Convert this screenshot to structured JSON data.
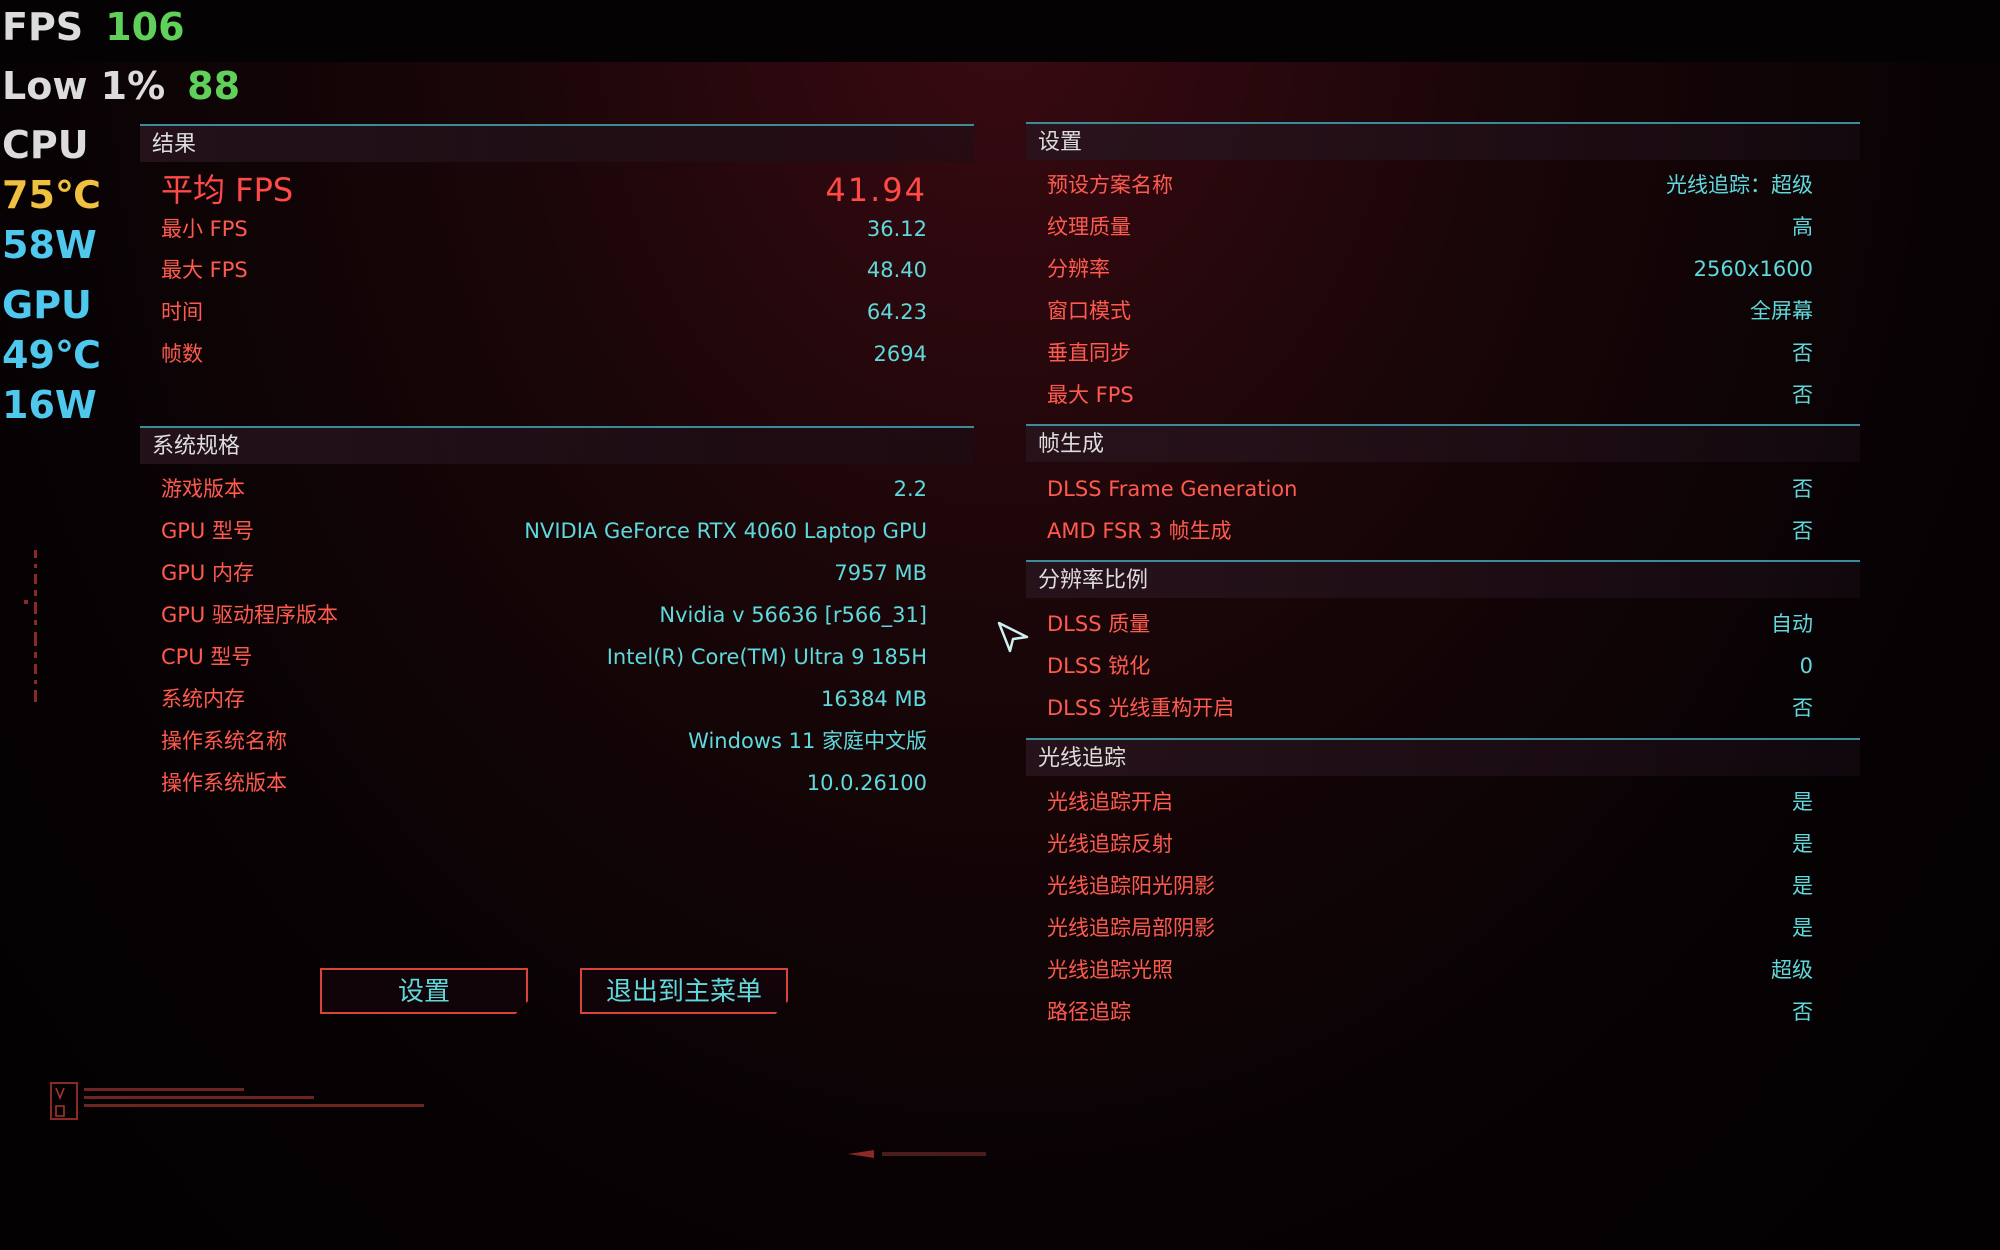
{
  "osd": {
    "fps_label": "FPS",
    "fps_value": "106",
    "low_label": "Low 1%",
    "low_value": "88",
    "cpu_label": "CPU",
    "cpu_temp": "75℃",
    "cpu_power": "58W",
    "gpu_label": "GPU",
    "gpu_temp": "49℃",
    "gpu_power": "16W",
    "colors": {
      "label": "#dcdcdc",
      "value_green": "#5fd05a",
      "cpu_temp": "#f0c040",
      "cyan": "#4fc8ee"
    }
  },
  "results": {
    "header": "结果",
    "average": {
      "label": "平均 FPS",
      "value": "41.94"
    },
    "rows": [
      {
        "label": "最小 FPS",
        "value": "36.12"
      },
      {
        "label": "最大 FPS",
        "value": "48.40"
      },
      {
        "label": "时间",
        "value": "64.23"
      },
      {
        "label": "帧数",
        "value": "2694"
      }
    ]
  },
  "system": {
    "header": "系统规格",
    "rows": [
      {
        "label": "游戏版本",
        "value": "2.2"
      },
      {
        "label": "GPU 型号",
        "value": "NVIDIA GeForce RTX 4060 Laptop GPU"
      },
      {
        "label": "GPU 内存",
        "value": "7957 MB"
      },
      {
        "label": "GPU 驱动程序版本",
        "value": "Nvidia v 56636 [r566_31]"
      },
      {
        "label": "CPU 型号",
        "value": "Intel(R) Core(TM) Ultra 9 185H"
      },
      {
        "label": "系统内存",
        "value": "16384 MB"
      },
      {
        "label": "操作系统名称",
        "value": "Windows 11 家庭中文版"
      },
      {
        "label": "操作系统版本",
        "value": "10.0.26100"
      }
    ]
  },
  "settings": {
    "header": "设置",
    "rows": [
      {
        "label": "预设方案名称",
        "value": "光线追踪：超级"
      },
      {
        "label": "纹理质量",
        "value": "高"
      },
      {
        "label": "分辨率",
        "value": "2560x1600"
      },
      {
        "label": "窗口模式",
        "value": "全屏幕"
      },
      {
        "label": "垂直同步",
        "value": "否"
      },
      {
        "label": "最大 FPS",
        "value": "否"
      }
    ]
  },
  "framegen": {
    "header": "帧生成",
    "rows": [
      {
        "label": "DLSS Frame Generation",
        "value": "否"
      },
      {
        "label": "AMD FSR 3 帧生成",
        "value": "否"
      }
    ]
  },
  "scaling": {
    "header": "分辨率比例",
    "rows": [
      {
        "label": "DLSS 质量",
        "value": "自动"
      },
      {
        "label": "DLSS 锐化",
        "value": "0"
      },
      {
        "label": "DLSS 光线重构开启",
        "value": "否"
      }
    ]
  },
  "raytracing": {
    "header": "光线追踪",
    "rows": [
      {
        "label": "光线追踪开启",
        "value": "是"
      },
      {
        "label": "光线追踪反射",
        "value": "是"
      },
      {
        "label": "光线追踪阳光阴影",
        "value": "是"
      },
      {
        "label": "光线追踪局部阴影",
        "value": "是"
      },
      {
        "label": "光线追踪光照",
        "value": "超级"
      },
      {
        "label": "路径追踪",
        "value": "否"
      }
    ]
  },
  "buttons": {
    "settings": "设置",
    "exit": "退出到主菜单"
  },
  "colors": {
    "key_red": "#ff5a4e",
    "value_cyan": "#5fd9dc",
    "divider_teal": "#3b8c98",
    "button_border": "#d8443c"
  }
}
